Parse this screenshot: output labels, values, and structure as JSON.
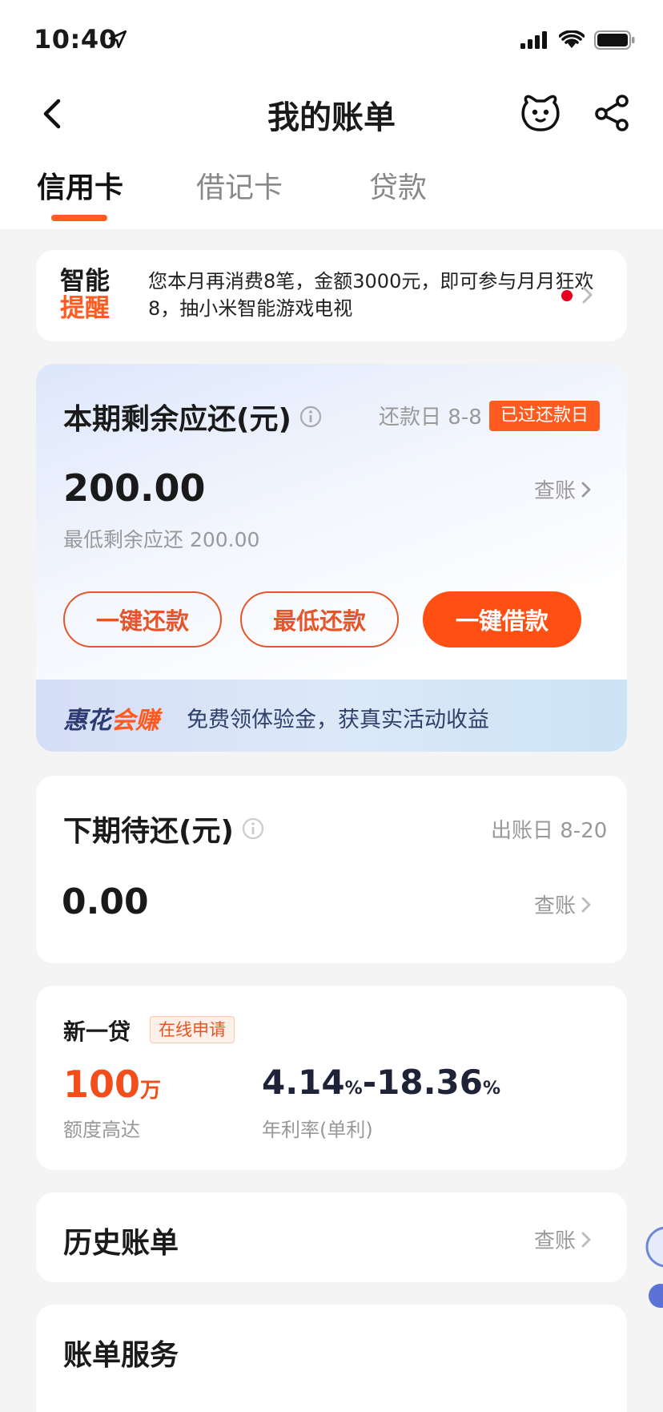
{
  "status_bar": {
    "time": "10:40"
  },
  "nav": {
    "title": "我的账单"
  },
  "tabs": [
    {
      "label": "信用卡",
      "active": true
    },
    {
      "label": "借记卡",
      "active": false
    },
    {
      "label": "贷款",
      "active": false
    }
  ],
  "reminder": {
    "logo_line1": "智能",
    "logo_line2": "提醒",
    "text": "您本月再消费8笔，金额3000元，即可参与月月狂欢8，抽小米智能游戏电视"
  },
  "current_bill": {
    "label": "本期剩余应还(元)",
    "due_date": "还款日 8-8",
    "overdue_badge": "已过还款日",
    "amount": "200.00",
    "view_label": "查账",
    "minimum": "最低剩余应还 200.00",
    "btn_repay_all": "一键还款",
    "btn_min_repay": "最低还款",
    "btn_borrow": "一键借款",
    "promo_logo_a": "惠花",
    "promo_logo_b": "会赚",
    "promo_text": "免费领体验金，获真实活动收益"
  },
  "next_bill": {
    "label": "下期待还(元)",
    "statement_date": "出账日 8-20",
    "amount": "0.00",
    "view_label": "查账"
  },
  "loan": {
    "name": "新一贷",
    "badge": "在线申请",
    "limit_value": "100",
    "limit_unit": "万",
    "limit_label": "额度高达",
    "rate_low": "4.14",
    "rate_high": "18.36",
    "rate_unit": "%",
    "rate_sep": "-",
    "rate_label": "年利率(单利)"
  },
  "history": {
    "label": "历史账单",
    "view_label": "查账"
  },
  "services": {
    "label": "账单服务"
  },
  "colors": {
    "accent": "#ff5a1f",
    "overdue": "#ff5a1f",
    "loan_limit": "#f04e1a"
  }
}
